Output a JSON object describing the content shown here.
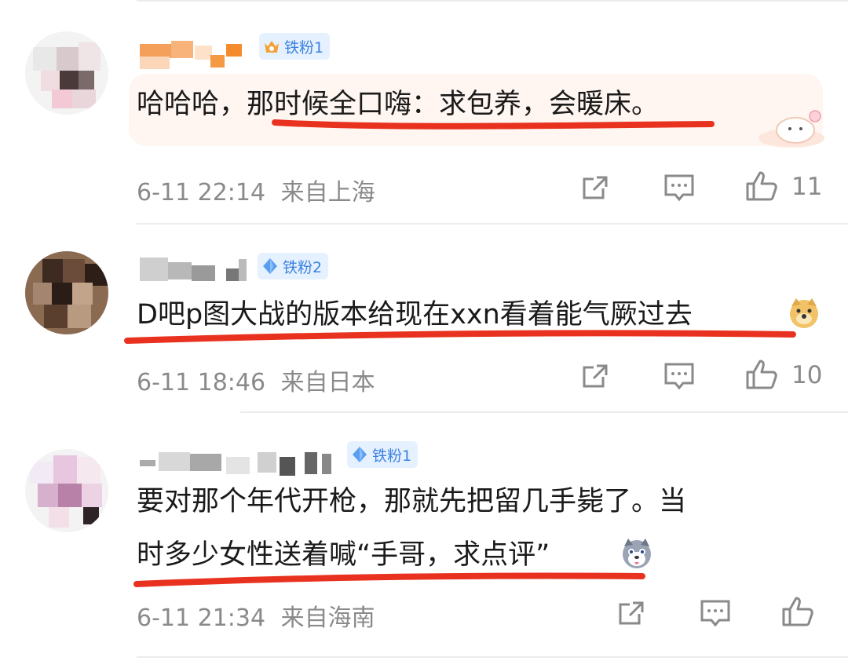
{
  "comments": [
    {
      "badge": "铁粉1",
      "text": "哈哈哈，那时候全口嗨：求包养，会暖床。",
      "time": "6-11 22:14",
      "location": "来自上海",
      "likes": "11"
    },
    {
      "badge": "铁粉2",
      "text": "D吧p图大战的版本给现在xxn看着能气厥过去",
      "time": "6-11 18:46",
      "location": "来自日本",
      "likes": "10"
    },
    {
      "badge": "铁粉1",
      "text_line1": "要对那个年代开枪，那就先把留几手毙了。当",
      "text_line2": "时多少女性送着喊“手哥，求点评”",
      "time": "6-11 21:34",
      "location": "来自海南",
      "likes": ""
    }
  ],
  "icons": {
    "share": "share-icon",
    "comment": "comment-icon",
    "like": "thumbs-up-icon"
  },
  "colors": {
    "underline": "#e8321f",
    "badge_text": "#3b82e0",
    "meta": "#8a8a8a"
  }
}
